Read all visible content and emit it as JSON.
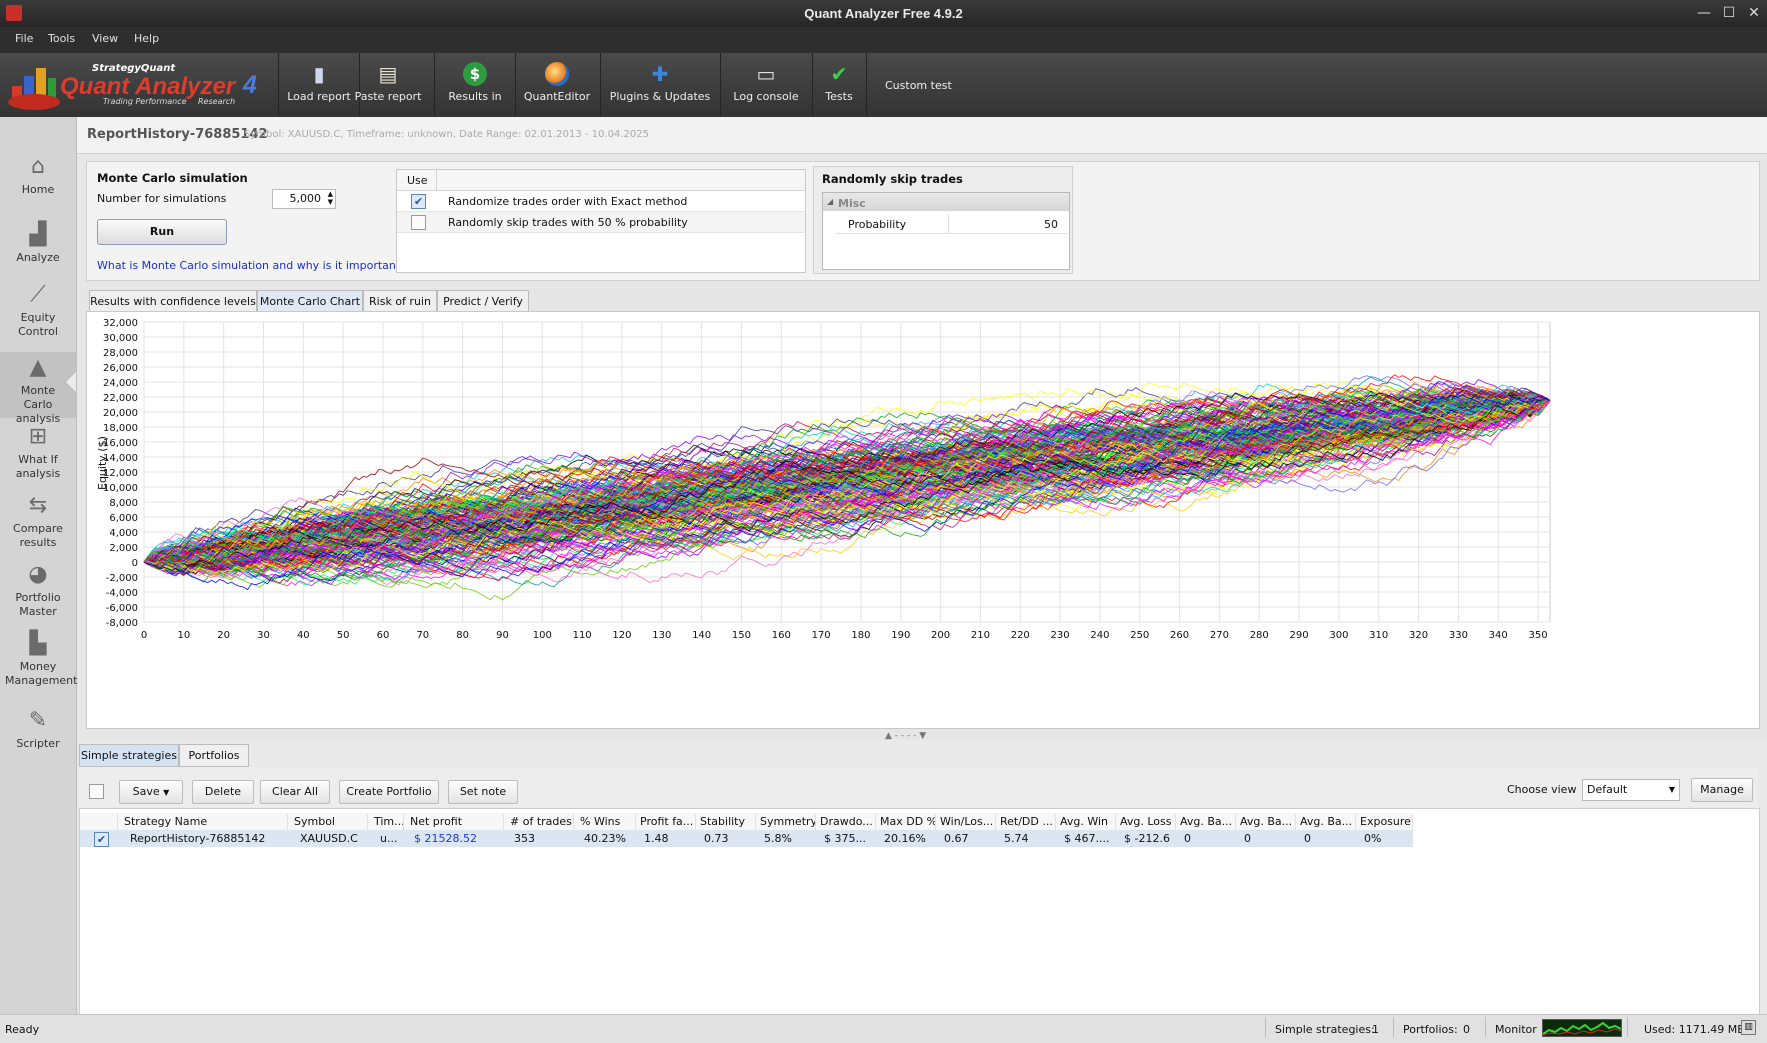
{
  "window": {
    "title": "Quant Analyzer Free 4.9.2",
    "controls": [
      "—",
      "☐",
      "✕"
    ]
  },
  "menu": [
    "File",
    "Tools",
    "View",
    "Help"
  ],
  "logo": {
    "brand_top": "StrategyQuant",
    "brand_main": "Quant Analyzer",
    "brand_version": "4",
    "brand_sub_left": "Trading Performance",
    "brand_sub_right": "Research"
  },
  "toolbar": [
    {
      "label": "Load report",
      "icon": "document-icon"
    },
    {
      "label": "Paste report",
      "icon": "clipboard-icon"
    },
    {
      "label": "Results in",
      "icon": "dollar-icon"
    },
    {
      "label": "QuantEditor",
      "icon": "globe-icon"
    },
    {
      "label": "Plugins & Updates",
      "icon": "puzzle-icon"
    },
    {
      "label": "Log console",
      "icon": "console-icon"
    },
    {
      "label": "Tests",
      "icon": "checkmark-icon"
    },
    {
      "label": "Custom test",
      "icon": ""
    }
  ],
  "sidebar": [
    {
      "label": "Home",
      "icon": "home-icon"
    },
    {
      "label": "Analyze",
      "icon": "bar-chart-icon"
    },
    {
      "label": "Equity Control",
      "icon": "line-chart-icon"
    },
    {
      "label": "Monte Carlo analysis",
      "icon": "area-chart-icon",
      "active": true
    },
    {
      "label": "What If analysis",
      "icon": "hierarchy-icon"
    },
    {
      "label": "Compare results",
      "icon": "compare-arrows-icon"
    },
    {
      "label": "Portfolio Master",
      "icon": "pie-chart-icon"
    },
    {
      "label": "Money Management",
      "icon": "histogram-icon"
    },
    {
      "label": "Scripter",
      "icon": "pencil-icon"
    }
  ],
  "report": {
    "name": "ReportHistory-76885142",
    "info": "Symbol: XAUUSD.C, Timeframe: unknown, Date Range: 02.01.2013 - 10.04.2025"
  },
  "monte_carlo": {
    "heading": "Monte Carlo simulation",
    "num_label": "Number for simulations",
    "num_value": "5,000",
    "run_label": "Run",
    "link": "What is Monte Carlo simulation and why is it important?",
    "use_header": "Use",
    "methods": [
      {
        "label": "Randomize trades order with Exact method",
        "checked": true
      },
      {
        "label": "Randomly skip trades with 50 % probability",
        "checked": false
      }
    ],
    "skip_panel": {
      "heading": "Randomly skip trades",
      "group": "Misc",
      "prop_label": "Probability",
      "prop_value": "50"
    }
  },
  "tabs": [
    "Results with confidence levels",
    "Monte Carlo Chart",
    "Risk of ruin",
    "Predict / Verify"
  ],
  "active_tab": "Monte Carlo Chart",
  "chart_data": {
    "type": "line",
    "ylabel": "Equity ($)",
    "xlabel": "",
    "xlim": [
      0,
      353
    ],
    "ylim": [
      -8000,
      32000
    ],
    "x_ticks": [
      "0",
      "10",
      "20",
      "30",
      "40",
      "50",
      "60",
      "70",
      "80",
      "90",
      "100",
      "110",
      "120",
      "130",
      "140",
      "150",
      "160",
      "170",
      "180",
      "190",
      "200",
      "210",
      "220",
      "230",
      "240",
      "250",
      "260",
      "270",
      "280",
      "290",
      "300",
      "310",
      "320",
      "330",
      "340",
      "350"
    ],
    "y_ticks": [
      "32,000",
      "30,000",
      "28,000",
      "26,000",
      "24,000",
      "22,000",
      "20,000",
      "18,000",
      "16,000",
      "14,000",
      "12,000",
      "10,000",
      "8,000",
      "6,000",
      "4,000",
      "2,000",
      "0",
      "-2,000",
      "-4,000",
      "-6,000",
      "-8,000"
    ],
    "num_trades": 353,
    "start_value": 0,
    "end_value": 21528.52,
    "grid": true,
    "series_count_drawn": 220,
    "series_note": "random-walk equity paths of shuffled trade order, all starting at 0 and ending at 21528.52",
    "palette": [
      "#ff0000",
      "#00aa00",
      "#0000ff",
      "#ff00ff",
      "#00cccc",
      "#ffcc00",
      "#ff8800",
      "#8800ff",
      "#00ff66",
      "#cc0066",
      "#6666ff",
      "#990000",
      "#009999",
      "#ff66cc",
      "#66cc00",
      "#333399",
      "#ffff00",
      "#000000"
    ]
  },
  "splitter": "▲ - - - - ▼",
  "bottom_tabs": [
    "Simple strategies",
    "Portfolios"
  ],
  "bottom_toolbar": {
    "save": "Save",
    "delete": "Delete",
    "clear_all": "Clear All",
    "create_portfolio": "Create Portfolio",
    "set_note": "Set note",
    "choose_view": "Choose view",
    "view_value": "Default",
    "manage": "Manage"
  },
  "table": {
    "headers": [
      "Strategy Name",
      "Symbol",
      "Tim...",
      "Net profit",
      "# of trades",
      "% Wins",
      "Profit fa...",
      "Stability",
      "Symmetry",
      "Drawdo...",
      "Max DD %",
      "Win/Los...",
      "Ret/DD ...",
      "Avg. Win",
      "Avg. Loss",
      "Avg. Ba...",
      "Avg. Ba...",
      "Avg. Ba...",
      "Exposure"
    ],
    "rows": [
      [
        "ReportHistory-76885142",
        "XAUUSD.C",
        "u...",
        "$ 21528.52",
        "353",
        "40.23%",
        "1.48",
        "0.73",
        "5.8%",
        "$ 375...",
        "20.16%",
        "0.67",
        "5.74",
        "$ 467....",
        "$ -212.6",
        "0",
        "0",
        "0",
        "0%"
      ]
    ]
  },
  "status": {
    "ready": "Ready",
    "simple_label": "Simple strategies:",
    "simple_value": "1",
    "portfolios_label": "Portfolios:",
    "portfolios_value": "0",
    "monitor_label": "Monitor",
    "used": "Used: 1171.49 MB"
  }
}
